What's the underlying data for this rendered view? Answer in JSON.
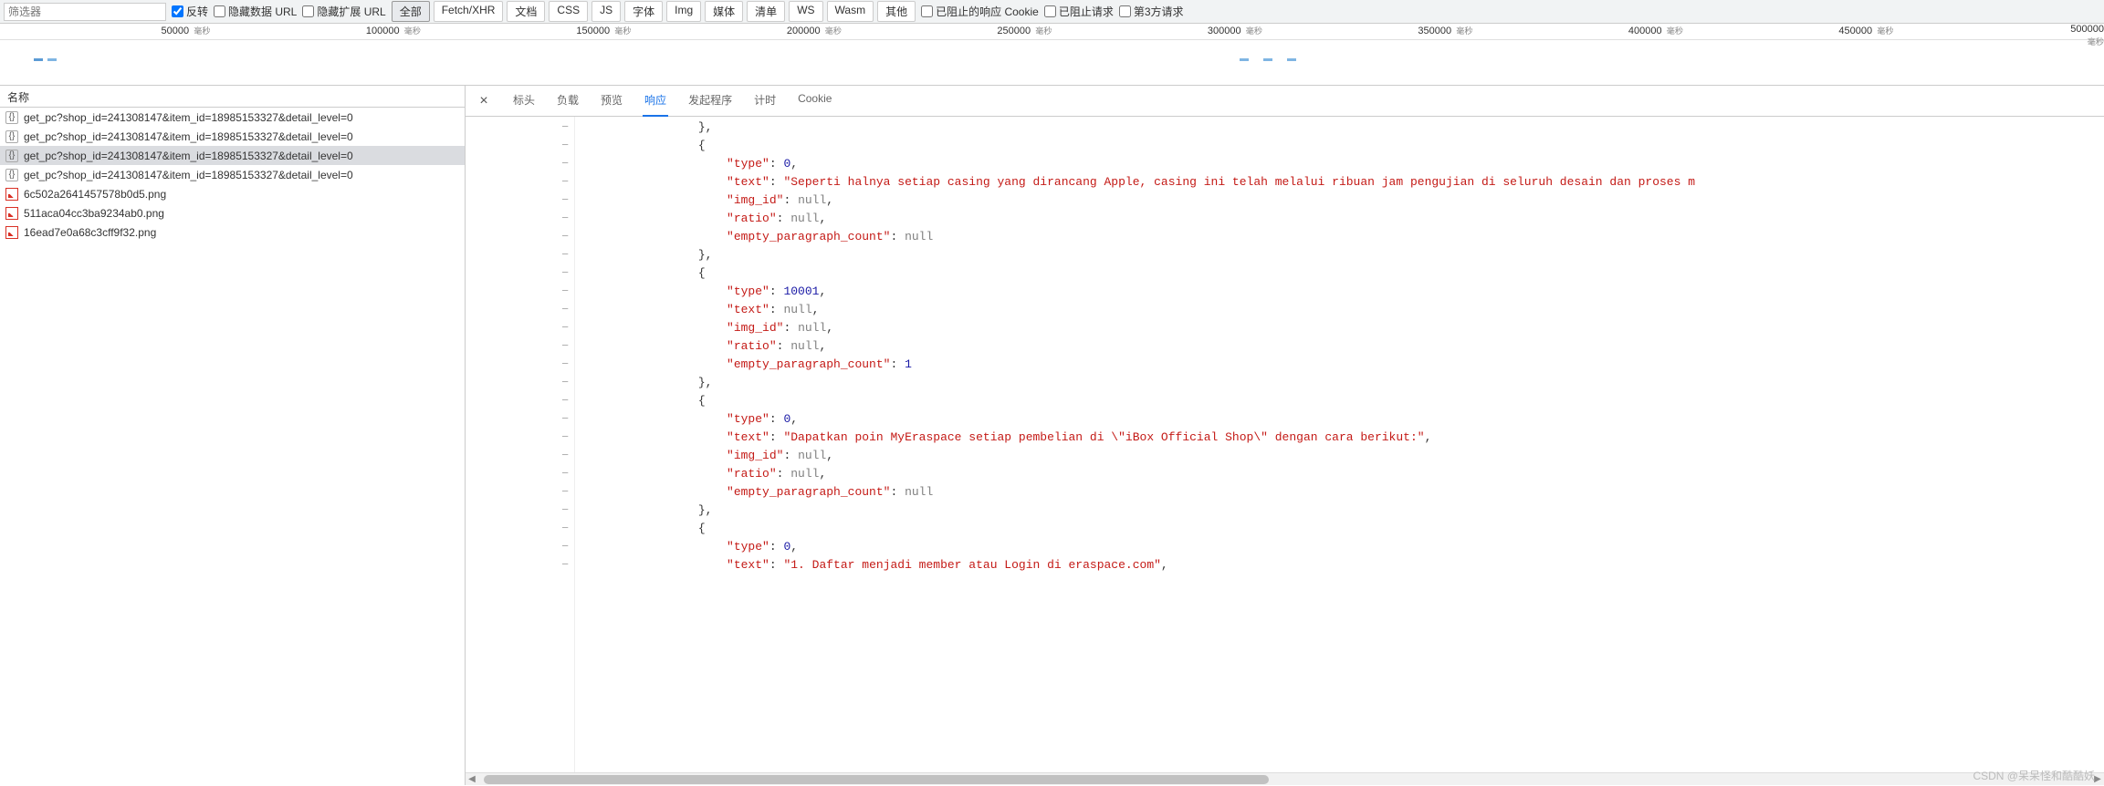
{
  "toolbar": {
    "filter_placeholder": "筛选器",
    "invert": "反转",
    "hide_data_url": "隐藏数据 URL",
    "hide_ext_url": "隐藏扩展 URL",
    "blocked_cookies": "已阻止的响应 Cookie",
    "blocked_req": "已阻止请求",
    "third_party": "第3方请求",
    "chips": [
      "全部",
      "Fetch/XHR",
      "文档",
      "CSS",
      "JS",
      "字体",
      "Img",
      "媒体",
      "清单",
      "WS",
      "Wasm",
      "其他"
    ],
    "active_chip": 0
  },
  "timeline": {
    "ticks": [
      {
        "v": "50000",
        "u": "毫秒"
      },
      {
        "v": "100000",
        "u": "毫秒"
      },
      {
        "v": "150000",
        "u": "毫秒"
      },
      {
        "v": "200000",
        "u": "毫秒"
      },
      {
        "v": "250000",
        "u": "毫秒"
      },
      {
        "v": "300000",
        "u": "毫秒"
      },
      {
        "v": "350000",
        "u": "毫秒"
      },
      {
        "v": "400000",
        "u": "毫秒"
      },
      {
        "v": "450000",
        "u": "毫秒"
      },
      {
        "v": "500000",
        "u": "毫秒"
      }
    ]
  },
  "left": {
    "header": "名称",
    "rows": [
      {
        "icon": "json",
        "name": "get_pc?shop_id=241308147&item_id=18985153327&detail_level=0"
      },
      {
        "icon": "json",
        "name": "get_pc?shop_id=241308147&item_id=18985153327&detail_level=0"
      },
      {
        "icon": "json",
        "name": "get_pc?shop_id=241308147&item_id=18985153327&detail_level=0",
        "selected": true
      },
      {
        "icon": "json",
        "name": "get_pc?shop_id=241308147&item_id=18985153327&detail_level=0"
      },
      {
        "icon": "img",
        "name": "6c502a2641457578b0d5.png"
      },
      {
        "icon": "img",
        "name": "511aca04cc3ba9234ab0.png"
      },
      {
        "icon": "img",
        "name": "16ead7e0a68c3cff9f32.png"
      }
    ]
  },
  "tabs": {
    "items": [
      "标头",
      "负载",
      "预览",
      "响应",
      "发起程序",
      "计时",
      "Cookie"
    ],
    "active": 3
  },
  "code": {
    "lines": [
      {
        "t": "},",
        "ind": 4
      },
      {
        "t": "{",
        "ind": 4
      },
      {
        "seg": [
          {
            "k": "\"type\"",
            "p": ": ",
            "n": "0",
            "e": ","
          }
        ],
        "ind": 5
      },
      {
        "seg": [
          {
            "k": "\"text\"",
            "p": ": ",
            "s": "\"Seperti halnya setiap casing yang dirancang Apple, casing ini telah melalui ribuan jam pengujian di seluruh desain dan proses m"
          }
        ],
        "ind": 5
      },
      {
        "seg": [
          {
            "k": "\"img_id\"",
            "p": ": ",
            "nl": "null",
            "e": ","
          }
        ],
        "ind": 5
      },
      {
        "seg": [
          {
            "k": "\"ratio\"",
            "p": ": ",
            "nl": "null",
            "e": ","
          }
        ],
        "ind": 5
      },
      {
        "seg": [
          {
            "k": "\"empty_paragraph_count\"",
            "p": ": ",
            "nl": "null"
          }
        ],
        "ind": 5
      },
      {
        "t": "},",
        "ind": 4
      },
      {
        "t": "{",
        "ind": 4
      },
      {
        "seg": [
          {
            "k": "\"type\"",
            "p": ": ",
            "n": "10001",
            "e": ","
          }
        ],
        "ind": 5
      },
      {
        "seg": [
          {
            "k": "\"text\"",
            "p": ": ",
            "nl": "null",
            "e": ","
          }
        ],
        "ind": 5
      },
      {
        "seg": [
          {
            "k": "\"img_id\"",
            "p": ": ",
            "nl": "null",
            "e": ","
          }
        ],
        "ind": 5
      },
      {
        "seg": [
          {
            "k": "\"ratio\"",
            "p": ": ",
            "nl": "null",
            "e": ","
          }
        ],
        "ind": 5
      },
      {
        "seg": [
          {
            "k": "\"empty_paragraph_count\"",
            "p": ": ",
            "n": "1"
          }
        ],
        "ind": 5
      },
      {
        "t": "},",
        "ind": 4
      },
      {
        "t": "{",
        "ind": 4
      },
      {
        "seg": [
          {
            "k": "\"type\"",
            "p": ": ",
            "n": "0",
            "e": ","
          }
        ],
        "ind": 5
      },
      {
        "seg": [
          {
            "k": "\"text\"",
            "p": ": ",
            "s": "\"Dapatkan poin MyEraspace setiap pembelian di \\\"iBox Official Shop\\\" dengan cara berikut:\"",
            "e": ","
          }
        ],
        "ind": 5
      },
      {
        "seg": [
          {
            "k": "\"img_id\"",
            "p": ": ",
            "nl": "null",
            "e": ","
          }
        ],
        "ind": 5
      },
      {
        "seg": [
          {
            "k": "\"ratio\"",
            "p": ": ",
            "nl": "null",
            "e": ","
          }
        ],
        "ind": 5
      },
      {
        "seg": [
          {
            "k": "\"empty_paragraph_count\"",
            "p": ": ",
            "nl": "null"
          }
        ],
        "ind": 5
      },
      {
        "t": "},",
        "ind": 4
      },
      {
        "t": "{",
        "ind": 4
      },
      {
        "seg": [
          {
            "k": "\"type\"",
            "p": ": ",
            "n": "0",
            "e": ","
          }
        ],
        "ind": 5
      },
      {
        "seg": [
          {
            "k": "\"text\"",
            "p": ": ",
            "s": "\"1. Daftar menjadi member atau Login di eraspace.com\"",
            "e": ","
          }
        ],
        "ind": 5
      }
    ]
  },
  "watermark": "CSDN @呆呆怪和酷酷妖"
}
